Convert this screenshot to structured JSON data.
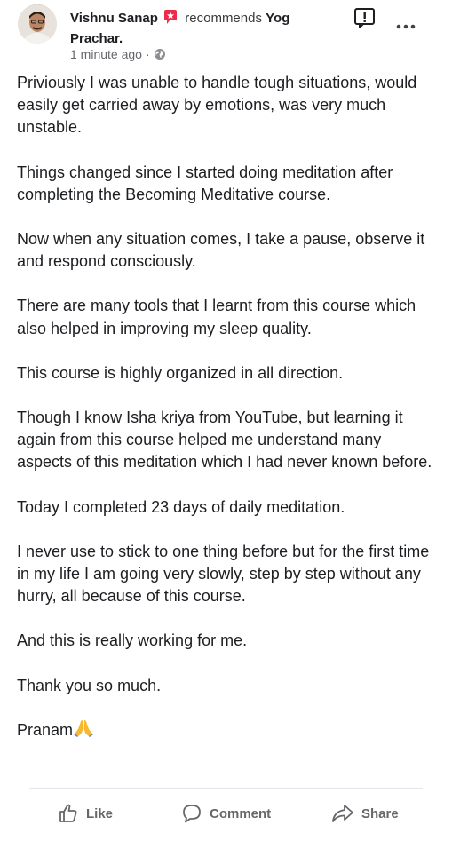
{
  "post": {
    "author": "Vishnu Sanap",
    "recommends_text": "recommends",
    "page_name": "Yog Prachar.",
    "timestamp": "1 minute ago",
    "separator": "·",
    "privacy_icon": "globe-icon",
    "report_icon": "report-flag-icon",
    "more_icon": "more-options-icon",
    "badge_icon": "recommend-badge-icon",
    "accent_badge_color": "#f02849",
    "paragraphs": [
      "Priviously I was unable to handle tough situations, would easily get carried away by emotions, was very much unstable.",
      "Things changed since I started doing meditation after completing the Becoming Meditative course.",
      "Now when any situation comes, I take a pause, observe it and respond consciously.",
      "There are many tools that I learnt from this course which also helped in improving my sleep quality.",
      "This course is highly organized in all direction.",
      "Though I know Isha kriya from YouTube, but learning it again from this course helped me understand many aspects of this meditation which I had never known before.",
      "Today I completed 23 days of daily meditation.",
      "I never use to stick to one thing before but for the first time in my life I am going very slowly, step by step without any hurry, all because of this course.",
      "And this is really working for me.",
      "Thank you so much."
    ],
    "closing": "Pranam",
    "closing_emoji": "🙏"
  },
  "actions": {
    "like_label": "Like",
    "comment_label": "Comment",
    "share_label": "Share",
    "like_icon": "thumbs-up-icon",
    "comment_icon": "comment-bubble-icon",
    "share_icon": "share-arrow-icon"
  }
}
